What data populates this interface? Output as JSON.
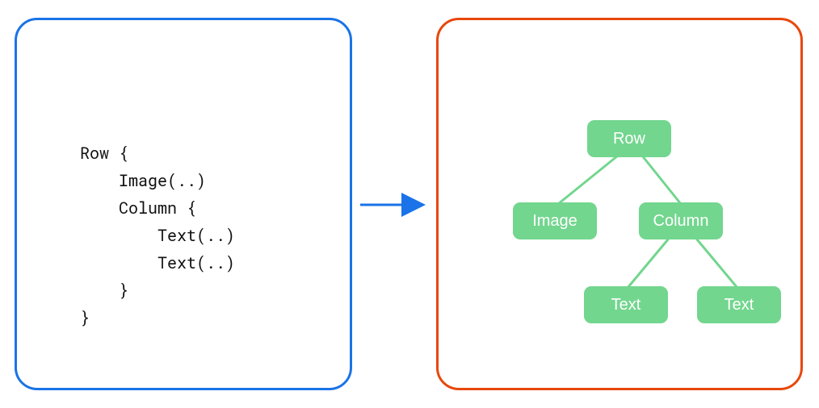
{
  "colors": {
    "blue": "#1a73e8",
    "orange": "#e8470b",
    "green": "#72d68e"
  },
  "code": {
    "l1": "Row {",
    "l2": "    Image(..)",
    "l3": "    Column {",
    "l4": "        Text(..)",
    "l5": "        Text(..)",
    "l6": "    }",
    "l7": "}"
  },
  "tree": {
    "root": "Row",
    "child_a": "Image",
    "child_b": "Column",
    "grand_a": "Text",
    "grand_b": "Text"
  }
}
